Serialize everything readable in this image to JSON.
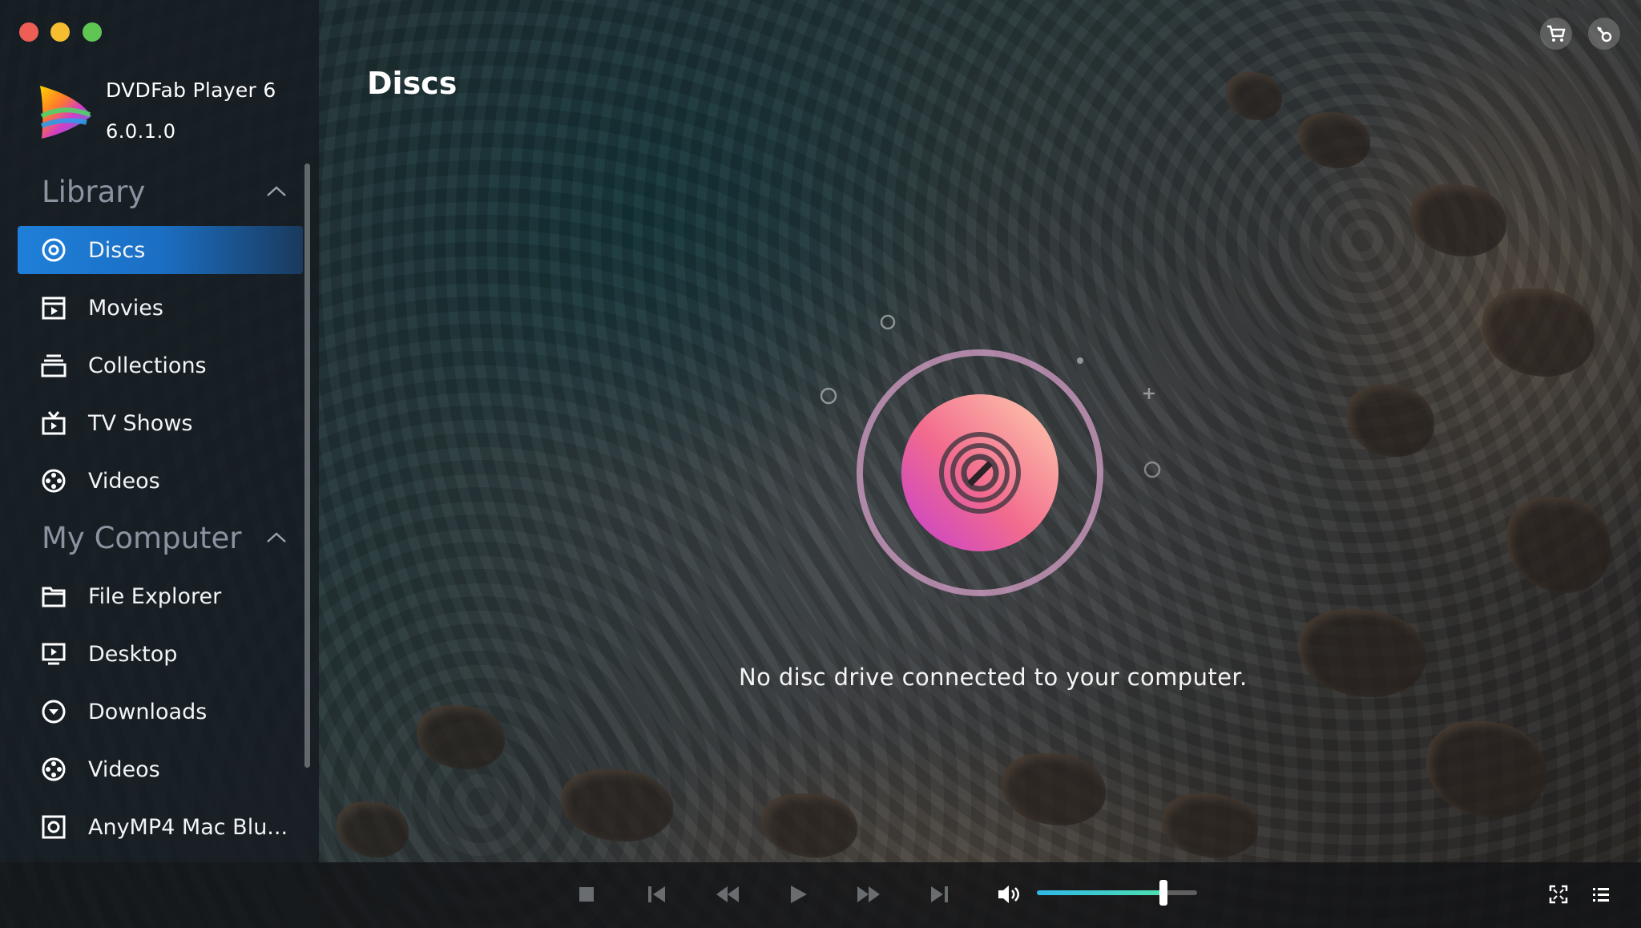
{
  "window": {
    "app_name": "DVDFab Player 6",
    "app_version": "6.0.1.0"
  },
  "sidebar": {
    "library": {
      "title": "Library",
      "items": [
        {
          "label": "Discs",
          "icon": "disc-icon",
          "active": true
        },
        {
          "label": "Movies",
          "icon": "movie-icon"
        },
        {
          "label": "Collections",
          "icon": "collections-icon"
        },
        {
          "label": "TV Shows",
          "icon": "tv-icon"
        },
        {
          "label": "Videos",
          "icon": "film-reel-icon"
        }
      ]
    },
    "my_computer": {
      "title": "My Computer",
      "items": [
        {
          "label": "File Explorer",
          "icon": "folder-icon"
        },
        {
          "label": "Desktop",
          "icon": "desktop-icon"
        },
        {
          "label": "Downloads",
          "icon": "download-icon"
        },
        {
          "label": "Videos",
          "icon": "film-reel-icon"
        },
        {
          "label": "AnyMP4 Mac Blu...",
          "icon": "drive-icon"
        }
      ]
    }
  },
  "main": {
    "title": "Discs",
    "message": "No disc drive connected to your computer."
  },
  "header_buttons": {
    "cart": "cart-icon",
    "register": "key-icon"
  },
  "player": {
    "volume_level": 0.79,
    "controls": [
      "stop-icon",
      "previous-icon",
      "rewind-icon",
      "play-icon",
      "fast-forward-icon",
      "next-icon",
      "volume-icon",
      "fullscreen-icon",
      "playlist-icon"
    ]
  },
  "colors": {
    "accent": "#1f7fd8",
    "disc_gradient_start": "#c43fd0",
    "disc_gradient_end": "#ffb09a",
    "ring": "#d6a0c8"
  }
}
